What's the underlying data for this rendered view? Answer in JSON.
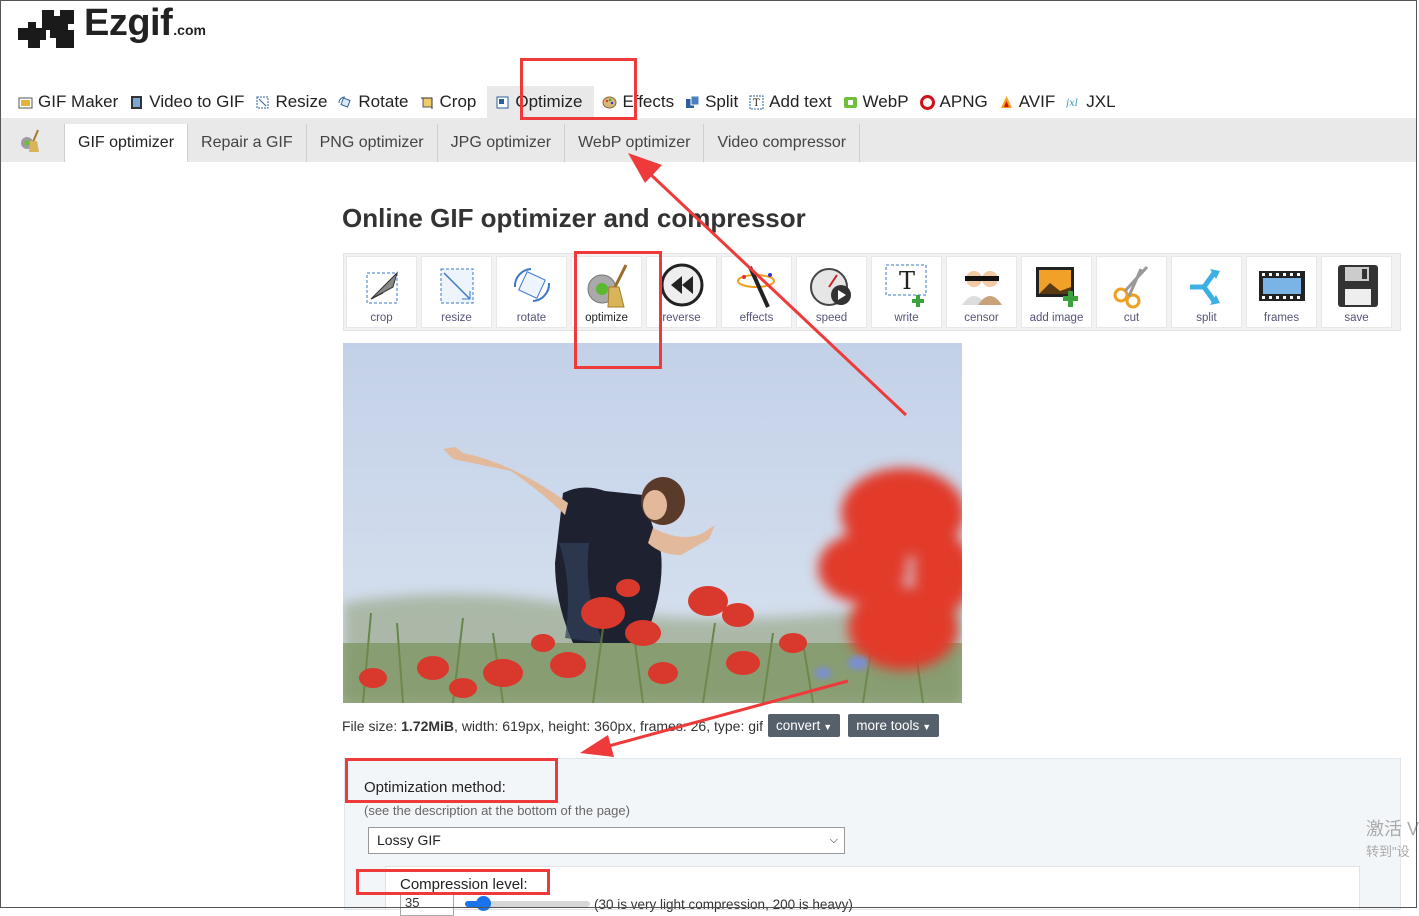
{
  "brand": {
    "name": "Ezgif",
    "suffix": ".com"
  },
  "top_nav": [
    {
      "label": "GIF Maker",
      "icon": "gif-maker-icon"
    },
    {
      "label": "Video to GIF",
      "icon": "film-icon"
    },
    {
      "label": "Resize",
      "icon": "resize-icon"
    },
    {
      "label": "Rotate",
      "icon": "rotate-icon"
    },
    {
      "label": "Crop",
      "icon": "crop-icon"
    },
    {
      "label": "Optimize",
      "icon": "optimize-icon",
      "active": true
    },
    {
      "label": "Effects",
      "icon": "palette-icon"
    },
    {
      "label": "Split",
      "icon": "split-icon"
    },
    {
      "label": "Add text",
      "icon": "add-text-icon"
    },
    {
      "label": "WebP",
      "icon": "webp-icon"
    },
    {
      "label": "APNG",
      "icon": "apng-icon"
    },
    {
      "label": "AVIF",
      "icon": "avif-icon"
    },
    {
      "label": "JXL",
      "icon": "jxl-icon"
    }
  ],
  "sub_nav": [
    {
      "label": "GIF optimizer",
      "active": true
    },
    {
      "label": "Repair a GIF"
    },
    {
      "label": "PNG optimizer"
    },
    {
      "label": "JPG optimizer"
    },
    {
      "label": "WebP optimizer"
    },
    {
      "label": "Video compressor"
    }
  ],
  "page_title": "Online GIF optimizer and compressor",
  "tools": [
    {
      "label": "crop",
      "icon": "crop-tool-icon"
    },
    {
      "label": "resize",
      "icon": "resize-tool-icon"
    },
    {
      "label": "rotate",
      "icon": "rotate-tool-icon"
    },
    {
      "label": "optimize",
      "icon": "optimize-tool-icon",
      "active": true
    },
    {
      "label": "reverse",
      "icon": "reverse-tool-icon"
    },
    {
      "label": "effects",
      "icon": "effects-tool-icon"
    },
    {
      "label": "speed",
      "icon": "speed-tool-icon"
    },
    {
      "label": "write",
      "icon": "write-tool-icon"
    },
    {
      "label": "censor",
      "icon": "censor-tool-icon"
    },
    {
      "label": "add image",
      "icon": "add-image-tool-icon"
    },
    {
      "label": "cut",
      "icon": "scissors-tool-icon"
    },
    {
      "label": "split",
      "icon": "split-tool-icon"
    },
    {
      "label": "frames",
      "icon": "frames-tool-icon"
    },
    {
      "label": "save",
      "icon": "save-tool-icon"
    }
  ],
  "file_info": {
    "prefix": "File size: ",
    "size": "1.72MiB",
    "rest": ", width: 619px, height: 360px, frames: 26, type: gif",
    "convert_label": "convert",
    "more_tools_label": "more tools"
  },
  "options": {
    "method_label": "Optimization method:",
    "method_desc": "(see the description at the bottom of the page)",
    "method_value": "Lossy GIF",
    "compression_label": "Compression level:",
    "compression_value": "35",
    "compression_hint": "(30 is very light compression, 200 is heavy)"
  },
  "watermark": {
    "line1": "激活 V",
    "line2": "转到\"设"
  },
  "colors": {
    "annotation": "#ee3a3a",
    "button_dark": "#55606b",
    "slider": "#1a73e8"
  }
}
